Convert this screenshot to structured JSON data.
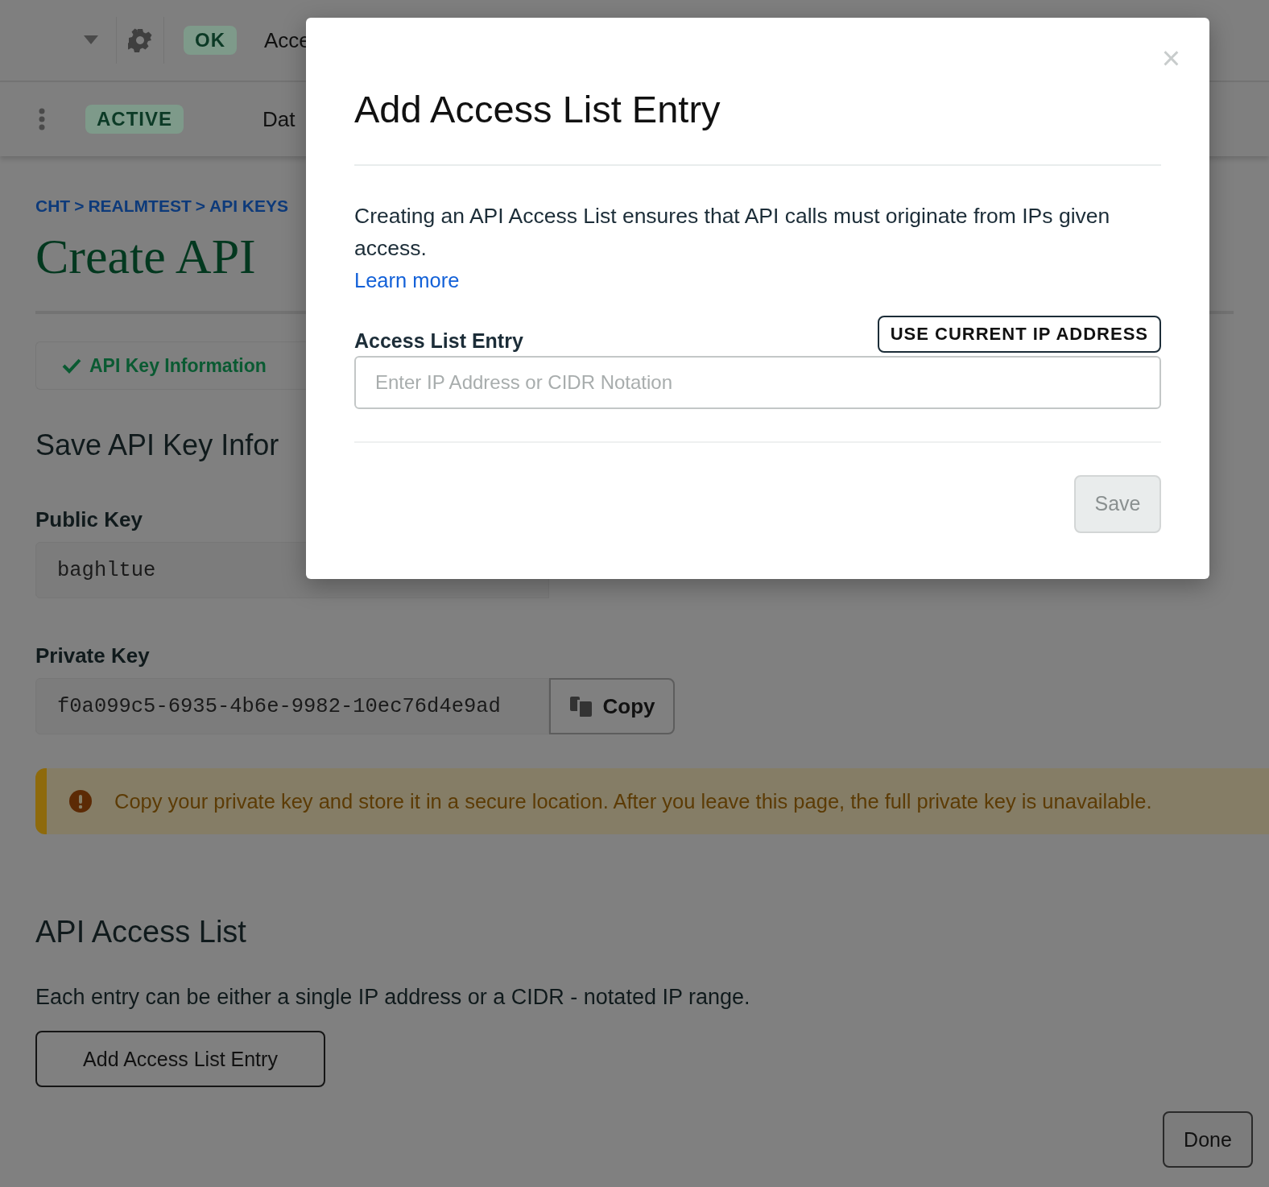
{
  "top_bar": {
    "status_badge": "OK",
    "tab_label": "Acce"
  },
  "project_bar": {
    "status_badge": "ACTIVE",
    "tab_label": "Dat"
  },
  "breadcrumb": {
    "items": [
      "CHT",
      "REALMTEST",
      "API KEYS"
    ],
    "separator": ">"
  },
  "page_title": "Create API",
  "step": {
    "label": "API Key Information",
    "completed": true
  },
  "section_title": "Save API Key Infor",
  "public_key": {
    "label": "Public Key",
    "value": "baghltue"
  },
  "private_key": {
    "label": "Private Key",
    "value": "f0a099c5-6935-4b6e-9982-10ec76d4e9ad",
    "copy_button": "Copy"
  },
  "warning": "Copy your private key and store it in a secure location. After you leave this page, the full private key is unavailable.",
  "access_list": {
    "title": "API Access List",
    "description": "Each entry can be either a single IP address or a CIDR - notated IP range.",
    "add_button": "Add Access List Entry"
  },
  "done_button": "Done",
  "modal": {
    "title": "Add Access List Entry",
    "close": "×",
    "description": "Creating an API Access List ensures that API calls must originate from IPs given access.",
    "link": "Learn more",
    "field_label": "Access List Entry",
    "current_ip_button": "USE CURRENT IP ADDRESS",
    "placeholder": "Enter IP Address or CIDR Notation",
    "save_button": {
      "label": "Save",
      "disabled": true
    }
  }
}
